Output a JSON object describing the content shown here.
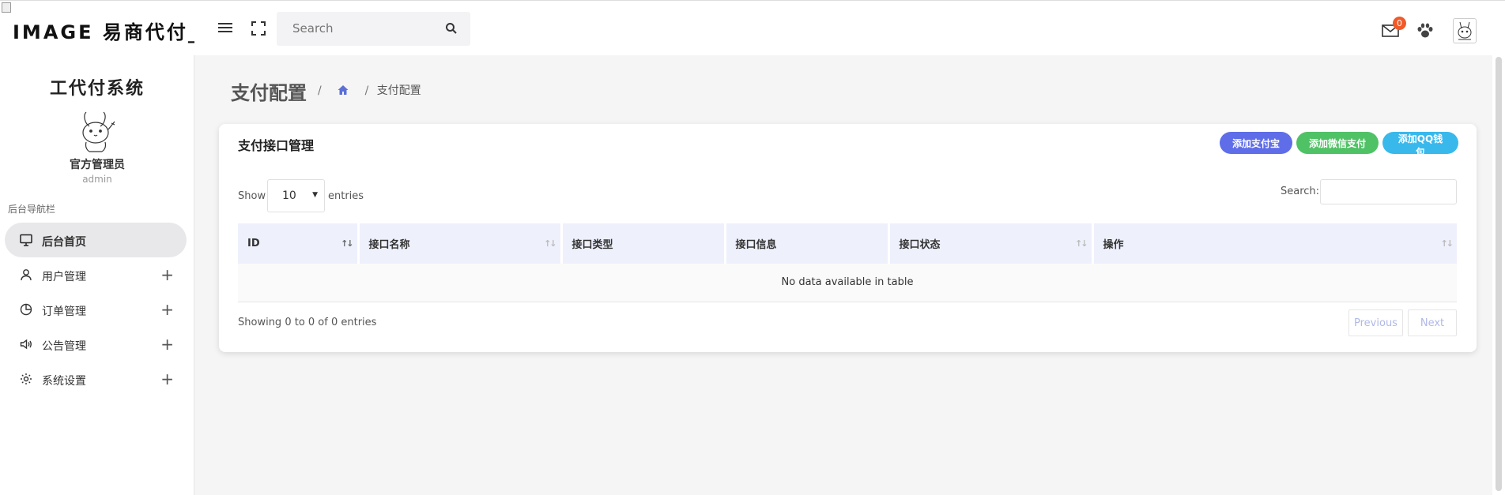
{
  "header": {
    "logo_text": "IMAGE 易商代付_手",
    "search_placeholder": "Search",
    "mail_count": "0"
  },
  "sidebar": {
    "system_title": "工代付系统",
    "admin_name": "官方管理员",
    "admin_user": "admin",
    "nav_label": "后台导航栏",
    "items": [
      {
        "label": "后台首页",
        "icon": "monitor-icon",
        "active": true
      },
      {
        "label": "用户管理",
        "icon": "user-icon"
      },
      {
        "label": "订单管理",
        "icon": "pie-chart-icon"
      },
      {
        "label": "公告管理",
        "icon": "speaker-icon"
      },
      {
        "label": "系统设置",
        "icon": "gear-icon"
      }
    ]
  },
  "page": {
    "title": "支付配置",
    "breadcrumb_sep": "/",
    "breadcrumb_current": "支付配置"
  },
  "card": {
    "title": "支付接口管理",
    "buttons": {
      "alipay": "添加支付宝",
      "wechat": "添加微信支付",
      "qq": "添加QQ钱包"
    },
    "show_label": "Show",
    "page_length": "10",
    "entries_label": "entries",
    "search_label": "Search:",
    "columns": [
      "ID",
      "接口名称",
      "接口类型",
      "接口信息",
      "接口状态",
      "操作"
    ],
    "empty_text": "No data available in table",
    "info_text": "Showing 0 to 0 of 0 entries",
    "prev_label": "Previous",
    "next_label": "Next"
  },
  "colors": {
    "alipay_btn": "#5f6ee8",
    "wechat_btn": "#50c266",
    "qq_btn": "#39b8ec",
    "badge": "#f05a28"
  }
}
